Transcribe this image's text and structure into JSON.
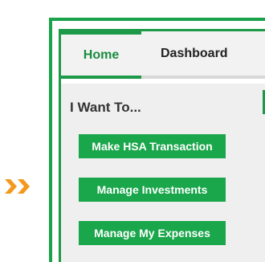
{
  "tabs": {
    "home": "Home",
    "dashboard": "Dashboard"
  },
  "section": {
    "heading": "I Want To..."
  },
  "actions": [
    {
      "label": "Make HSA Transaction"
    },
    {
      "label": "Manage Investments"
    },
    {
      "label": "Manage My Expenses"
    }
  ],
  "icons": {
    "pointer": "double-chevron-right-icon"
  },
  "colors": {
    "brand_green": "#1aa64b",
    "pointer_orange": "#f39a1e",
    "panel_gray": "#efefef"
  }
}
